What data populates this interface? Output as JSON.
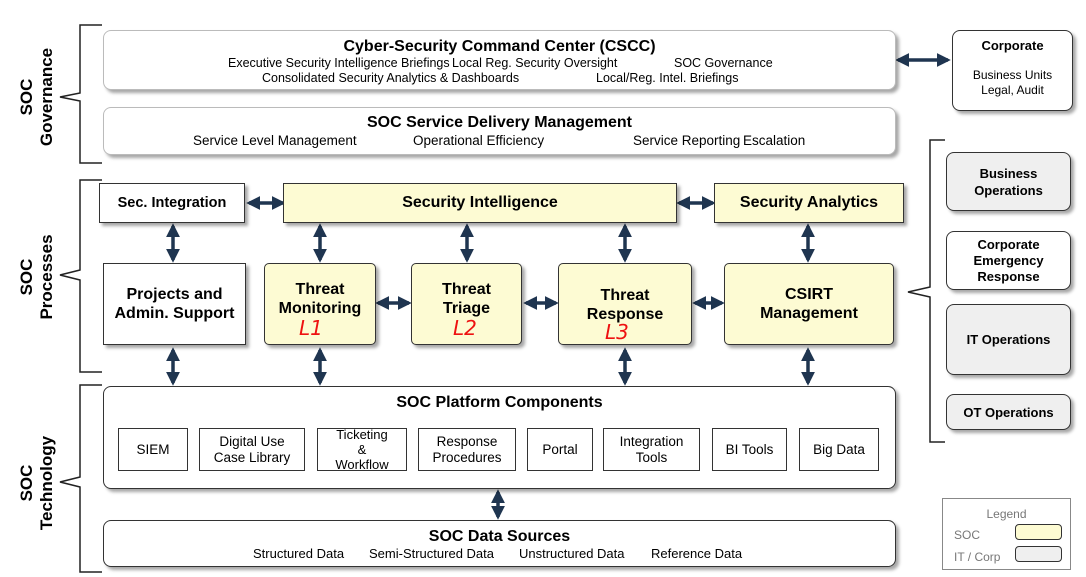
{
  "side_labels": {
    "governance": [
      "SOC",
      "Governance"
    ],
    "processes": [
      "SOC",
      "Processes"
    ],
    "technology": [
      "SOC",
      "Technology"
    ]
  },
  "cscc": {
    "title": "Cyber-Security Command Center (CSCC)",
    "items": [
      "Executive Security Intelligence Briefings",
      "Local Reg. Security Oversight",
      "SOC Governance",
      "Consolidated Security Analytics & Dashboards",
      "Local/Reg. Intel. Briefings"
    ]
  },
  "corporate": {
    "title": "Corporate",
    "lines": [
      "Business Units",
      "Legal, Audit"
    ]
  },
  "service_delivery": {
    "title": "SOC Service Delivery Management",
    "items": [
      "Service Level Management",
      "Operational Efficiency",
      "Service Reporting",
      "Escalation"
    ]
  },
  "processes": {
    "sec_integration": "Sec. Integration",
    "security_intelligence": "Security Intelligence",
    "security_analytics": "Security Analytics",
    "projects_admin": [
      "Projects and",
      "Admin. Support"
    ],
    "threat_monitoring": [
      "Threat",
      "Monitoring"
    ],
    "threat_triage": [
      "Threat",
      "Triage"
    ],
    "threat_response": [
      "Threat",
      "Response"
    ],
    "csirt": [
      "CSIRT",
      "Management"
    ],
    "levels": [
      "L1",
      "L2",
      "L3"
    ]
  },
  "right_column": {
    "business_ops": [
      "Business",
      "Operations"
    ],
    "corp_emergency": [
      "Corporate",
      "Emergency",
      "Response"
    ],
    "it_ops": "IT Operations",
    "ot_ops": "OT Operations"
  },
  "platform": {
    "title": "SOC Platform Components",
    "items": [
      [
        "SIEM"
      ],
      [
        "Digital Use",
        "Case Library"
      ],
      [
        "Ticketing",
        "&",
        "Workflow"
      ],
      [
        "Response",
        "Procedures"
      ],
      [
        "Portal"
      ],
      [
        "Integration",
        "Tools"
      ],
      [
        "BI Tools"
      ],
      [
        "Big Data"
      ]
    ]
  },
  "data_sources": {
    "title": "SOC Data Sources",
    "items": [
      "Structured Data",
      "Semi-Structured Data",
      "Unstructured Data",
      "Reference Data"
    ]
  },
  "legend": {
    "title": "Legend",
    "soc": "SOC",
    "it_corp": "IT / Corp",
    "colors": {
      "soc": "#fdfbd3",
      "it_corp": "#efefef"
    }
  },
  "colors": {
    "arrow": "#1f3550"
  }
}
